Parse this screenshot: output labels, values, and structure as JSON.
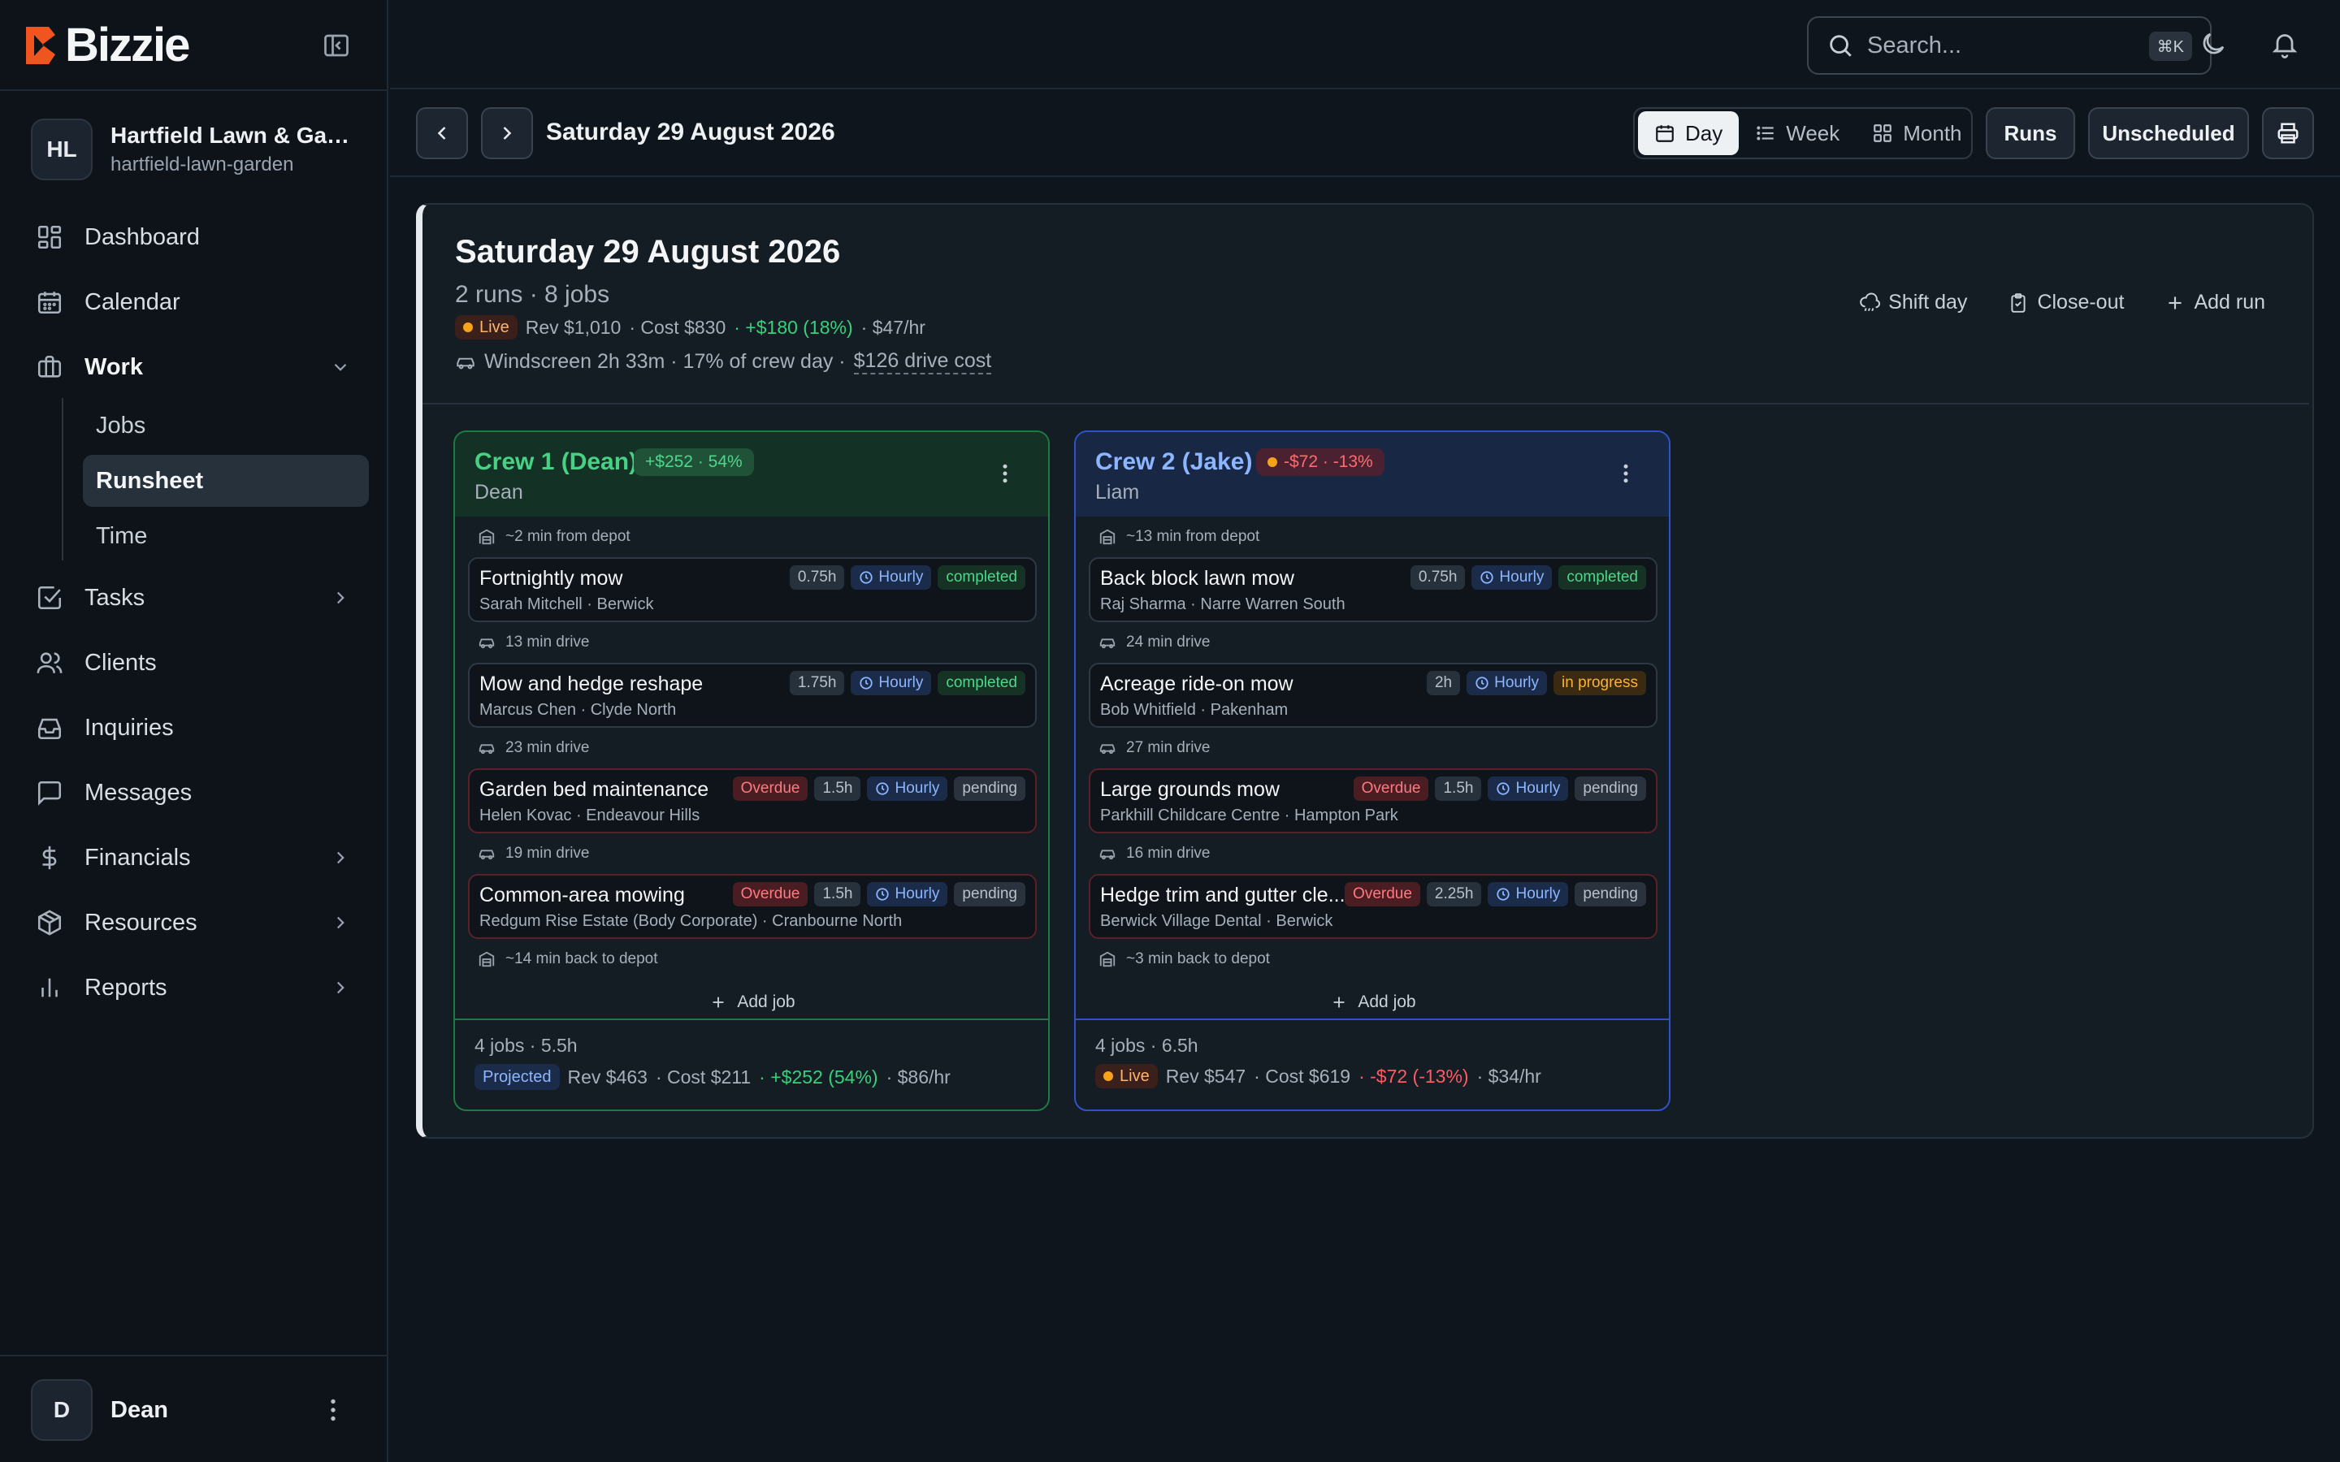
{
  "brand": {
    "name": "Bizzie"
  },
  "org": {
    "initials": "HL",
    "name": "Hartfield Lawn & Garden",
    "slug": "hartfield-lawn-garden"
  },
  "nav": {
    "dashboard": "Dashboard",
    "calendar": "Calendar",
    "work": "Work",
    "jobs": "Jobs",
    "runsheet": "Runsheet",
    "time": "Time",
    "tasks": "Tasks",
    "clients": "Clients",
    "inquiries": "Inquiries",
    "messages": "Messages",
    "financials": "Financials",
    "resources": "Resources",
    "reports": "Reports"
  },
  "user": {
    "initial": "D",
    "name": "Dean"
  },
  "search": {
    "placeholder": "Search...",
    "shortcut": "⌘K"
  },
  "toolbar": {
    "date": "Saturday 29 August 2026",
    "views": {
      "day": "Day",
      "week": "Week",
      "month": "Month"
    },
    "runs": "Runs",
    "unscheduled": "Unscheduled"
  },
  "day": {
    "title": "Saturday 29 August 2026",
    "summary": "2 runs · 8 jobs",
    "status": "Live",
    "rev": "Rev $1,010",
    "cost": "· Cost $830",
    "profit": "· +$180 (18%)",
    "rate": "· $47/hr",
    "windscreen": "Windscreen 2h 33m · 17% of crew day ·",
    "drive_cost": "$126 drive cost",
    "actions": {
      "shift": "Shift day",
      "closeout": "Close-out",
      "addrun": "Add run"
    }
  },
  "crews": [
    {
      "name": "Crew 1 (Dean)",
      "pill": "+$252 · 54%",
      "lead": "Dean",
      "depart": "~2 min from depot",
      "jobs": [
        {
          "title": "Fortnightly mow",
          "sub": "Sarah Mitchell · Berwick",
          "overdue": "",
          "dur": "0.75h",
          "rate": "Hourly",
          "status": "completed",
          "drive_after": "13 min drive"
        },
        {
          "title": "Mow and hedge reshape",
          "sub": "Marcus Chen · Clyde North",
          "overdue": "",
          "dur": "1.75h",
          "rate": "Hourly",
          "status": "completed",
          "drive_after": "23 min drive"
        },
        {
          "title": "Garden bed maintenance",
          "sub": "Helen Kovac · Endeavour Hills",
          "overdue": "Overdue",
          "dur": "1.5h",
          "rate": "Hourly",
          "status": "pending",
          "drive_after": "19 min drive"
        },
        {
          "title": "Common-area mowing",
          "sub": "Redgum Rise Estate (Body Corporate) · Cranbourne North",
          "overdue": "Overdue",
          "dur": "1.5h",
          "rate": "Hourly",
          "status": "pending",
          "drive_after": ""
        }
      ],
      "return": "~14 min back to depot",
      "add_job": "Add job",
      "foot_summary": "4 jobs · 5.5h",
      "foot_status": "Projected",
      "foot_rev": "Rev $463",
      "foot_cost": "· Cost $211",
      "foot_profit": "· +$252 (54%)",
      "foot_rate": "· $86/hr"
    },
    {
      "name": "Crew 2 (Jake)",
      "pill": "-$72 · -13%",
      "lead": "Liam",
      "depart": "~13 min from depot",
      "jobs": [
        {
          "title": "Back block lawn mow",
          "sub": "Raj Sharma · Narre Warren South",
          "overdue": "",
          "dur": "0.75h",
          "rate": "Hourly",
          "status": "completed",
          "drive_after": "24 min drive"
        },
        {
          "title": "Acreage ride-on mow",
          "sub": "Bob Whitfield · Pakenham",
          "overdue": "",
          "dur": "2h",
          "rate": "Hourly",
          "status": "in progress",
          "drive_after": "27 min drive"
        },
        {
          "title": "Large grounds mow",
          "sub": "Parkhill Childcare Centre · Hampton Park",
          "overdue": "Overdue",
          "dur": "1.5h",
          "rate": "Hourly",
          "status": "pending",
          "drive_after": "16 min drive"
        },
        {
          "title": "Hedge trim and gutter cle...",
          "sub": "Berwick Village Dental · Berwick",
          "overdue": "Overdue",
          "dur": "2.25h",
          "rate": "Hourly",
          "status": "pending",
          "drive_after": ""
        }
      ],
      "return": "~3 min back to depot",
      "add_job": "Add job",
      "foot_summary": "4 jobs · 6.5h",
      "foot_status": "Live",
      "foot_rev": "Rev $547",
      "foot_cost": "· Cost $619",
      "foot_profit": "· -$72 (-13%)",
      "foot_rate": "· $34/hr"
    }
  ]
}
